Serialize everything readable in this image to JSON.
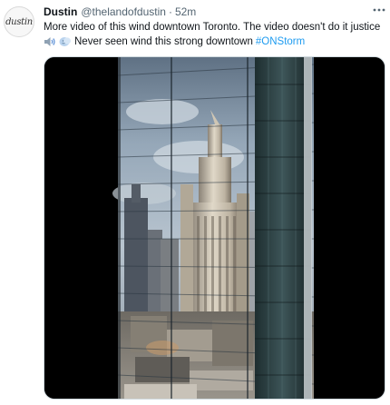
{
  "tweet": {
    "author_name": "Dustin",
    "author_handle": "@thelandofdustin",
    "separator": "·",
    "timestamp": "52m",
    "avatar_text": "dustin",
    "text_line1": "More video of this wind downtown Toronto. The video doesn't do it justice",
    "text_line2": "Never seen wind this strong downtown",
    "hashtag": "#ONStorm",
    "emojis": [
      "speaker-loud-icon",
      "wind-face-icon"
    ]
  },
  "colors": {
    "link": "#1d9bf0",
    "secondary_text": "#536471",
    "primary_text": "#0f1419",
    "media_background": "#000000"
  },
  "icons": {
    "more": "more-options-icon"
  },
  "media": {
    "type": "video",
    "description_icon": "video-player"
  }
}
